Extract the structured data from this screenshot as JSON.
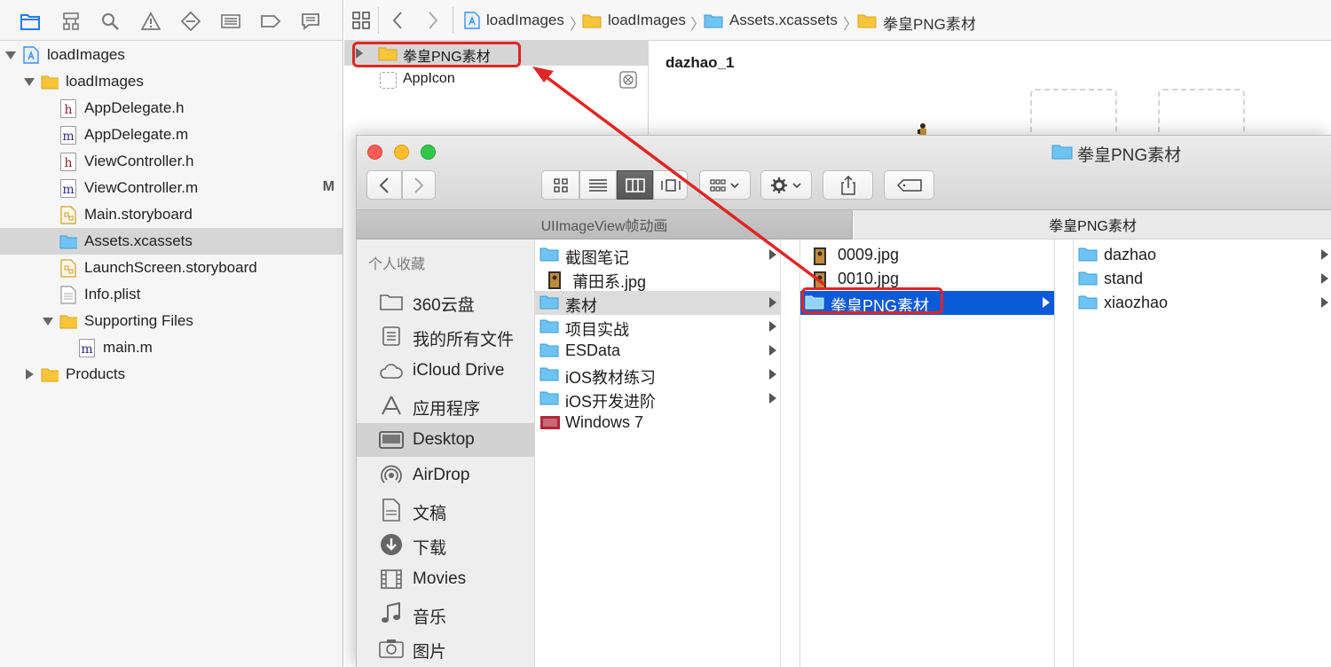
{
  "xcode": {
    "navigator_tree": [
      {
        "label": "loadImages",
        "icon": "project-icon",
        "expanded": true
      },
      {
        "label": "loadImages",
        "icon": "folder-icon",
        "expanded": true
      },
      {
        "label": "AppDelegate.h",
        "icon": "header-file-icon",
        "glyph": "h"
      },
      {
        "label": "AppDelegate.m",
        "icon": "source-file-icon",
        "glyph": "m"
      },
      {
        "label": "ViewController.h",
        "icon": "header-file-icon",
        "glyph": "h"
      },
      {
        "label": "ViewController.m",
        "icon": "source-file-icon",
        "glyph": "m",
        "badge": "M"
      },
      {
        "label": "Main.storyboard",
        "icon": "storyboard-icon"
      },
      {
        "label": "Assets.xcassets",
        "icon": "asset-catalog-icon",
        "selected": true
      },
      {
        "label": "LaunchScreen.storyboard",
        "icon": "storyboard-icon"
      },
      {
        "label": "Info.plist",
        "icon": "plist-icon"
      },
      {
        "label": "Supporting Files",
        "icon": "folder-icon",
        "expanded": true
      },
      {
        "label": "main.m",
        "icon": "source-file-icon",
        "glyph": "m"
      },
      {
        "label": "Products",
        "icon": "folder-icon",
        "expanded": false
      }
    ],
    "jump_bar": [
      "loadImages",
      "loadImages",
      "Assets.xcassets",
      "拳皇PNG素材"
    ],
    "asset_list": [
      "拳皇PNG素材",
      "AppIcon"
    ],
    "asset_name": "dazhao_1"
  },
  "finder": {
    "title": "拳皇PNG素材",
    "tabs": [
      "UIImageView帧动画",
      "拳皇PNG素材"
    ],
    "sidebar_header": "个人收藏",
    "sidebar": [
      "360云盘",
      "我的所有文件",
      "iCloud Drive",
      "应用程序",
      "Desktop",
      "AirDrop",
      "文稿",
      "下载",
      "Movies",
      "音乐",
      "图片"
    ],
    "sidebar_selected": "Desktop",
    "col1": [
      {
        "label": "截图笔记",
        "type": "folder",
        "arrow": true
      },
      {
        "label": "莆田系.jpg",
        "type": "image",
        "arrow": false
      },
      {
        "label": "素材",
        "type": "folder",
        "arrow": true,
        "highlight": true
      },
      {
        "label": "项目实战",
        "type": "folder",
        "arrow": true
      },
      {
        "label": "ESData",
        "type": "folder",
        "arrow": true
      },
      {
        "label": "iOS教材练习",
        "type": "folder",
        "arrow": true
      },
      {
        "label": "iOS开发进阶",
        "type": "folder",
        "arrow": true
      },
      {
        "label": "Windows 7",
        "type": "vm",
        "arrow": false
      }
    ],
    "col2": [
      {
        "label": "0009.jpg",
        "type": "image",
        "arrow": false
      },
      {
        "label": "0010.jpg",
        "type": "image",
        "arrow": false
      },
      {
        "label": "拳皇PNG素材",
        "type": "folder",
        "arrow": true,
        "selected": true
      }
    ],
    "col3": [
      {
        "label": "dazhao",
        "type": "folder",
        "arrow": true
      },
      {
        "label": "stand",
        "type": "folder",
        "arrow": true
      },
      {
        "label": "xiaozhao",
        "type": "folder",
        "arrow": true
      }
    ]
  },
  "colors": {
    "selection_blue": "#0b5ad8",
    "annotation_red": "#e02525",
    "folder_yellow": "#f8c53a",
    "folder_blue": "#6fc3f2"
  }
}
